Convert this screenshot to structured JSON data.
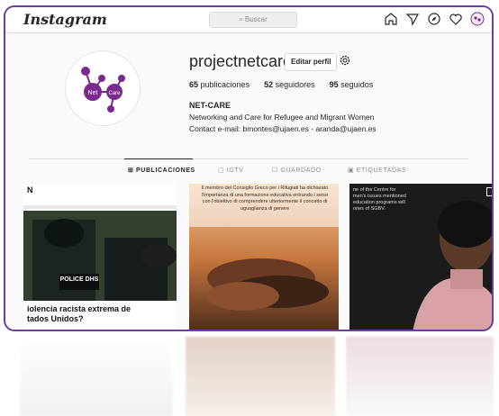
{
  "header": {
    "logo_text": "Instagram",
    "search_placeholder": "Buscar",
    "icons": [
      "home-icon",
      "direct-icon",
      "explore-icon",
      "heart-icon",
      "profile-avatar-icon"
    ]
  },
  "profile": {
    "username": "projectnetcare",
    "edit_label": "Editar perfil",
    "stats": {
      "posts_count": "65",
      "posts_label": "publicaciones",
      "followers_count": "52",
      "followers_label": "seguidores",
      "following_count": "95",
      "following_label": "seguidos"
    },
    "name": "NET-CARE",
    "bio_line1": "Networking and Care for Refugee and Migrant Women",
    "bio_line2": "Contact e-mail: bmontes@ujaen.es - aranda@ujaen.es",
    "avatar_text_net": "Net",
    "avatar_text_care": "Care"
  },
  "tabs": [
    {
      "label": "PUBLICACIONES",
      "icon": "grid-icon",
      "active": true
    },
    {
      "label": "IGTV",
      "icon": "igtv-icon",
      "active": false
    },
    {
      "label": "GUARDADO",
      "icon": "bookmark-icon",
      "active": false
    },
    {
      "label": "ETIQUETADAS",
      "icon": "tagged-icon",
      "active": false
    }
  ],
  "posts": [
    {
      "corner_letter": "N",
      "badge_text": "POLICE DHS",
      "caption_line1": "iolencia racista extrema de",
      "caption_line2": "tados Unidos?"
    },
    {
      "caption": "Il membro del Consiglio Greco per i Rifugiati ha dichiarato l'importanza di una formazione educativa entrando i sensi con l'obiettivo di comprendere ulteriormente il concetto di uguaglianza di genere"
    },
    {
      "caption_line1": "ne of the Centre for",
      "caption_line2": "men's issues mentioned",
      "caption_line3": "education programs will",
      "caption_line4": "ories of SGBV."
    }
  ],
  "colors": {
    "frame_border": "#6b3f9a",
    "logo_purple": "#7a2a8f"
  }
}
